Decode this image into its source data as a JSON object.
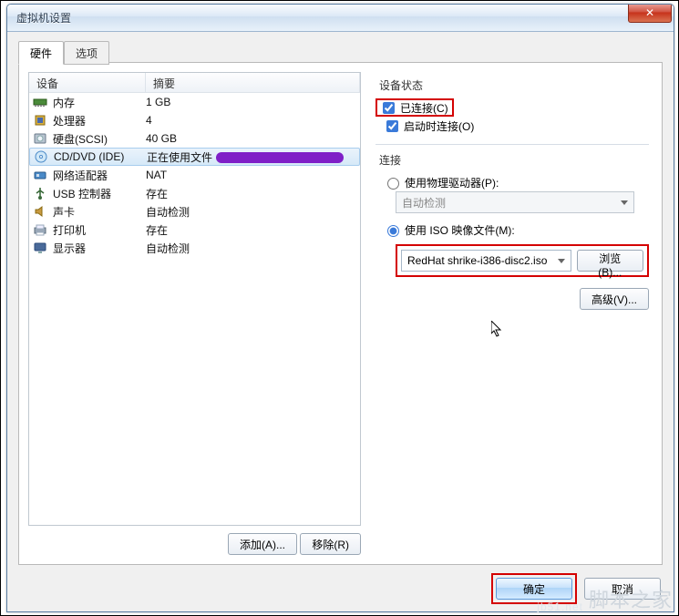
{
  "window": {
    "title": "虚拟机设置",
    "close": "✕"
  },
  "tabs": {
    "hardware": "硬件",
    "options": "选项"
  },
  "columns": {
    "device": "设备",
    "summary": "摘要"
  },
  "devices": [
    {
      "icon": "memory",
      "label": "内存",
      "summary": "1 GB"
    },
    {
      "icon": "cpu",
      "label": "处理器",
      "summary": "4"
    },
    {
      "icon": "hdd",
      "label": "硬盘(SCSI)",
      "summary": "40 GB"
    },
    {
      "icon": "cd",
      "label": "CD/DVD (IDE)",
      "summary": "正在使用文件"
    },
    {
      "icon": "net",
      "label": "网络适配器",
      "summary": "NAT"
    },
    {
      "icon": "usb",
      "label": "USB 控制器",
      "summary": "存在"
    },
    {
      "icon": "sound",
      "label": "声卡",
      "summary": "自动检测"
    },
    {
      "icon": "printer",
      "label": "打印机",
      "summary": "存在"
    },
    {
      "icon": "display",
      "label": "显示器",
      "summary": "自动检测"
    }
  ],
  "buttons": {
    "add": "添加(A)...",
    "remove": "移除(R)",
    "browse": "浏览(B)...",
    "advanced": "高级(V)...",
    "ok": "确定",
    "cancel": "取消"
  },
  "status": {
    "title": "设备状态",
    "connected": "已连接(C)",
    "connectAtPower": "启动时连接(O)"
  },
  "connection": {
    "title": "连接",
    "physical": "使用物理驱动器(P):",
    "physicalValue": "自动检测",
    "iso": "使用 ISO 映像文件(M):",
    "isoValue": "RedHat shrike-i386-disc2.iso"
  },
  "watermark": {
    "url": "jb51.net",
    "cn": "脚本之家"
  }
}
